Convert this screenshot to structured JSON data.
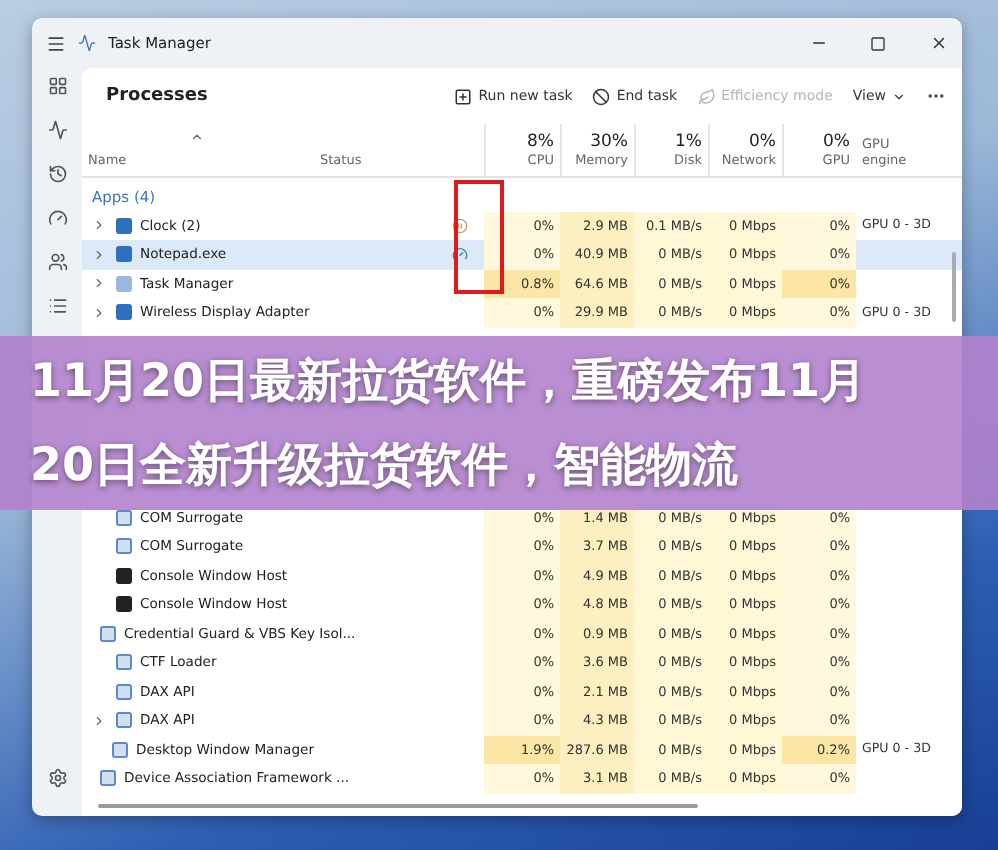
{
  "window": {
    "title": "Task Manager"
  },
  "toolbar": {
    "title": "Processes",
    "actions": [
      {
        "kind": "run",
        "label": "Run new task",
        "disabled": false
      },
      {
        "kind": "end",
        "label": "End task",
        "disabled": false
      },
      {
        "kind": "leaf",
        "label": "Efficiency mode",
        "disabled": true
      }
    ],
    "view": "View"
  },
  "columns": [
    {
      "label": "Name"
    },
    {
      "label": "Status"
    },
    {
      "label": "CPU",
      "total": "8%"
    },
    {
      "label": "Memory",
      "total": "30%"
    },
    {
      "label": "Disk",
      "total": "1%"
    },
    {
      "label": "Network",
      "total": "0%"
    },
    {
      "label": "GPU",
      "total": "0%"
    },
    {
      "label": "GPU engine"
    }
  ],
  "apps": {
    "title": "Apps (4)",
    "rows": [
      {
        "kind": "app",
        "name": "Clock (2)",
        "expandable": true,
        "selected": false,
        "busy": false,
        "suspended": true,
        "efficiency_mode": false,
        "cpu": "0%",
        "memory": "2.9 MB",
        "disk": "0.1 MB/s",
        "network": "0 Mbps",
        "gpu": "0%",
        "gpu_engine": "GPU 0 - 3D"
      },
      {
        "kind": "app",
        "name": "Notepad.exe",
        "expandable": true,
        "selected": true,
        "busy": false,
        "suspended": false,
        "efficiency_mode": true,
        "cpu": "0%",
        "memory": "40.9 MB",
        "disk": "0 MB/s",
        "network": "0 Mbps",
        "gpu": "0%"
      },
      {
        "kind": "chart",
        "name": "Task Manager",
        "expandable": true,
        "selected": false,
        "busy": true,
        "suspended": false,
        "efficiency_mode": false,
        "cpu": "0.8%",
        "memory": "64.6 MB",
        "disk": "0 MB/s",
        "network": "0 Mbps",
        "gpu": "0%"
      },
      {
        "kind": "app",
        "name": "Wireless Display Adapter",
        "expandable": true,
        "selected": false,
        "busy": false,
        "suspended": false,
        "efficiency_mode": false,
        "cpu": "0%",
        "memory": "29.9 MB",
        "disk": "0 MB/s",
        "network": "0 Mbps",
        "gpu": "0%",
        "gpu_engine": "GPU 0 - 3D"
      }
    ]
  },
  "background": {
    "rows": [
      {
        "kind": "service",
        "name": "COM Surrogate",
        "expandable": false,
        "selected": false,
        "busy": false,
        "suspended": false,
        "efficiency_mode": false,
        "cpu": "0%",
        "memory": "1.4 MB",
        "disk": "0 MB/s",
        "network": "0 Mbps",
        "gpu": "0%"
      },
      {
        "kind": "service",
        "name": "COM Surrogate",
        "expandable": false,
        "selected": false,
        "busy": false,
        "suspended": false,
        "efficiency_mode": false,
        "cpu": "0%",
        "memory": "3.7 MB",
        "disk": "0 MB/s",
        "network": "0 Mbps",
        "gpu": "0%"
      },
      {
        "kind": "console",
        "name": "Console Window Host",
        "expandable": false,
        "selected": false,
        "busy": false,
        "suspended": false,
        "efficiency_mode": false,
        "cpu": "0%",
        "memory": "4.9 MB",
        "disk": "0 MB/s",
        "network": "0 Mbps",
        "gpu": "0%"
      },
      {
        "kind": "console",
        "name": "Console Window Host",
        "expandable": false,
        "selected": false,
        "busy": false,
        "suspended": false,
        "efficiency_mode": false,
        "cpu": "0%",
        "memory": "4.8 MB",
        "disk": "0 MB/s",
        "network": "0 Mbps",
        "gpu": "0%"
      },
      {
        "kind": "service",
        "name": "Credential Guard & VBS Key Isol...",
        "expandable": false,
        "selected": false,
        "busy": false,
        "suspended": false,
        "efficiency_mode": false,
        "cpu": "0%",
        "memory": "0.9 MB",
        "disk": "0 MB/s",
        "network": "0 Mbps",
        "gpu": "0%"
      },
      {
        "kind": "service",
        "name": "CTF Loader",
        "expandable": false,
        "selected": false,
        "busy": false,
        "suspended": false,
        "efficiency_mode": false,
        "cpu": "0%",
        "memory": "3.6 MB",
        "disk": "0 MB/s",
        "network": "0 Mbps",
        "gpu": "0%"
      },
      {
        "kind": "service",
        "name": "DAX API",
        "expandable": false,
        "selected": false,
        "busy": false,
        "suspended": false,
        "efficiency_mode": false,
        "cpu": "0%",
        "memory": "2.1 MB",
        "disk": "0 MB/s",
        "network": "0 Mbps",
        "gpu": "0%"
      },
      {
        "kind": "service",
        "name": "DAX API",
        "expandable": true,
        "selected": false,
        "busy": false,
        "suspended": false,
        "efficiency_mode": false,
        "cpu": "0%",
        "memory": "4.3 MB",
        "disk": "0 MB/s",
        "network": "0 Mbps",
        "gpu": "0%"
      },
      {
        "kind": "service",
        "name": "Desktop Window Manager",
        "expandable": false,
        "selected": false,
        "busy": true,
        "suspended": false,
        "efficiency_mode": false,
        "cpu": "1.9%",
        "memory": "287.6 MB",
        "disk": "0 MB/s",
        "network": "0 Mbps",
        "gpu": "0.2%",
        "gpu_engine": "GPU 0 - 3D"
      },
      {
        "kind": "service",
        "name": "Device Association Framework ...",
        "expandable": false,
        "selected": false,
        "busy": false,
        "suspended": false,
        "efficiency_mode": false,
        "cpu": "0%",
        "memory": "3.1 MB",
        "disk": "0 MB/s",
        "network": "0 Mbps",
        "gpu": "0%"
      }
    ]
  },
  "banner": {
    "text": "11月20日最新拉货软件，重磅发布11月20日全新升级拉货软件，智能物流"
  }
}
